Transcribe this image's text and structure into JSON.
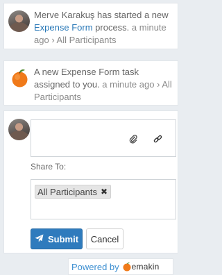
{
  "feed": [
    {
      "actor": "Merve Karakuş",
      "action_text": " has started a new ",
      "link_text": "Expense Form",
      "tail_text": " process. ",
      "time": "a minute ago",
      "separator": " › ",
      "audience": "All Participants"
    },
    {
      "message_text": "A new Expense Form task assigned to you. ",
      "time": "a minute ago",
      "separator": " › ",
      "audience": "All Participants"
    }
  ],
  "composer": {
    "comment_value": "",
    "attach_icon": "paperclip-icon",
    "link_icon": "link-icon",
    "share_label": "Share To:",
    "share_tag": "All Participants",
    "remove_tag_glyph": "✖",
    "submit_label": "Submit",
    "cancel_label": "Cancel"
  },
  "footer": {
    "powered_by": "Powered by",
    "brand": "emakin"
  },
  "colors": {
    "accent": "#2f7bbd",
    "link": "#2a79b8",
    "background": "#e9edf1"
  }
}
